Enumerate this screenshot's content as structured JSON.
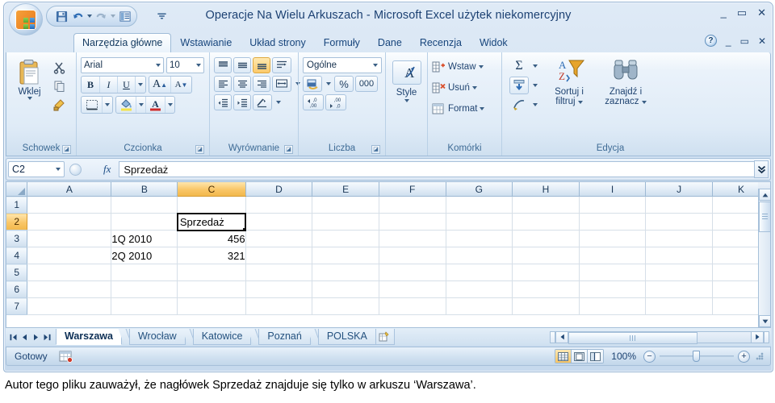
{
  "window": {
    "title": "Operacje Na Wielu Arkuszach - Microsoft Excel użytek niekomercyjny",
    "minimize": "_",
    "maximize": "▭",
    "close": "✕"
  },
  "quick_access": {
    "items": [
      {
        "name": "save-icon",
        "tooltip": "Zapisz"
      },
      {
        "name": "undo-icon",
        "tooltip": "Cofnij"
      },
      {
        "name": "redo-icon",
        "tooltip": "Wykonaj ponownie"
      },
      {
        "name": "print-preview-icon",
        "tooltip": "Podgląd wydruku"
      }
    ],
    "customize": "▾"
  },
  "ribbon": {
    "tabs": [
      {
        "label": "Narzędzia główne",
        "active": true
      },
      {
        "label": "Wstawianie",
        "active": false
      },
      {
        "label": "Układ strony",
        "active": false
      },
      {
        "label": "Formuły",
        "active": false
      },
      {
        "label": "Dane",
        "active": false
      },
      {
        "label": "Recenzja",
        "active": false
      },
      {
        "label": "Widok",
        "active": false
      }
    ],
    "help": "?",
    "minimize_ribbon": "_",
    "restore_window": "▭",
    "close_window": "✕",
    "groups": {
      "clipboard": {
        "label": "Schowek",
        "paste": "Wklej",
        "cut": "cut-scissors-icon",
        "copy": "copy-icon",
        "format_painter": "format-painter-icon",
        "dialog": "◪"
      },
      "font": {
        "label": "Czcionka",
        "font_name": "Arial",
        "font_size": "10",
        "bold": "B",
        "italic": "I",
        "underline": "U",
        "grow_font": "A",
        "shrink_font": "A",
        "borders": "borders-icon",
        "fill_color": "fill-color-icon",
        "font_color": "font-color-icon",
        "dialog": "◪"
      },
      "alignment": {
        "label": "Wyrównanie",
        "top_align": "align-top-icon",
        "middle_align": "align-middle-icon",
        "bottom_align": "align-bottom-icon",
        "wrap_text": "wrap-text-icon",
        "align_left": "align-left-icon",
        "align_center": "align-center-icon",
        "align_right": "align-right-icon",
        "merge_center": "merge-center-icon",
        "decrease_indent": "decrease-indent-icon",
        "increase_indent": "increase-indent-icon",
        "orientation": "orientation-icon",
        "dialog": "◪"
      },
      "number": {
        "label": "Liczba",
        "format": "Ogólne",
        "accounting": "accounting-format-icon",
        "percent": "%",
        "comma": "000",
        "increase_decimal": "increase-decimal-icon",
        "decrease_decimal": "decrease-decimal-icon",
        "dialog": "◪"
      },
      "styles": {
        "label": "Style",
        "button": "Style",
        "dropdown": "▾"
      },
      "cells": {
        "label": "Komórki",
        "insert": "Wstaw",
        "delete": "Usuń",
        "format": "Format"
      },
      "editing": {
        "label": "Edycja",
        "autosum": "Σ",
        "fill": "fill-down-icon",
        "clear": "clear-eraser-icon",
        "sort_filter_line1": "Sortuj i",
        "sort_filter_line2": "filtruj",
        "find_select_line1": "Znajdź i",
        "find_select_line2": "zaznacz"
      }
    }
  },
  "formula_bar": {
    "name_box": "C2",
    "fx": "fx",
    "value": "Sprzedaż",
    "expand": "⌄⌄"
  },
  "grid": {
    "columns": [
      "A",
      "B",
      "C",
      "D",
      "E",
      "F",
      "G",
      "H",
      "I",
      "J",
      "K"
    ],
    "selected_column": "C",
    "rows": [
      "1",
      "2",
      "3",
      "4",
      "5",
      "6",
      "7"
    ],
    "selected_row": "2",
    "active_cell": "C2",
    "cells": [
      {
        "row": "2",
        "col": "C",
        "value": "Sprzedaż",
        "align": "left",
        "selected": true
      },
      {
        "row": "3",
        "col": "B",
        "value": "1Q 2010",
        "align": "left",
        "selected": false
      },
      {
        "row": "3",
        "col": "C",
        "value": "456",
        "align": "right",
        "selected": false
      },
      {
        "row": "4",
        "col": "B",
        "value": "2Q 2010",
        "align": "left",
        "selected": false
      },
      {
        "row": "4",
        "col": "C",
        "value": "321",
        "align": "right",
        "selected": false
      }
    ]
  },
  "sheet_tabs": {
    "nav_first": "◀|",
    "nav_prev": "◀",
    "nav_next": "▶",
    "nav_last": "|▶",
    "tabs": [
      {
        "label": "Warszawa",
        "active": true
      },
      {
        "label": "Wrocław",
        "active": false
      },
      {
        "label": "Katowice",
        "active": false
      },
      {
        "label": "Poznań",
        "active": false
      },
      {
        "label": "POLSKA",
        "active": false
      }
    ],
    "new_sheet": "insert-worksheet-icon"
  },
  "status_bar": {
    "status": "Gotowy",
    "macro_icon": "record-macro-icon",
    "views": [
      {
        "name": "normal-view",
        "active": true
      },
      {
        "name": "page-layout-view",
        "active": false
      },
      {
        "name": "page-break-preview",
        "active": false
      }
    ],
    "zoom": "100%",
    "zoom_out": "−",
    "zoom_in": "+"
  },
  "caption": "Autor tego pliku zauważył, że nagłówek Sprzedaż znajduje się tylko w arkuszu ‘Warszawa’."
}
